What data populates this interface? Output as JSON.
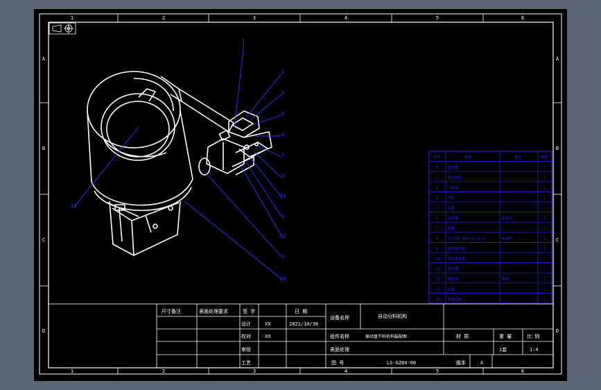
{
  "background_color": "#5b6573",
  "paper_color": "#000000",
  "frame_color": "#ffffff",
  "bom_color": "#2222ff",
  "leader_color": "#3030ff",
  "border_zones": {
    "top": [
      "1",
      "2",
      "3",
      "4",
      "5",
      "6"
    ],
    "bottom": [
      "1",
      "2",
      "3",
      "4",
      "5",
      "6"
    ],
    "left": [
      "A",
      "B",
      "C",
      "D"
    ],
    "right": [
      "A",
      "B",
      "C",
      "D"
    ]
  },
  "balloons": [
    "1",
    "2",
    "3",
    "8",
    "4",
    "7",
    "1",
    "10",
    "3",
    "12",
    "9",
    "11",
    "13"
  ],
  "bom": {
    "headers": [
      "序号",
      "名称",
      "备注",
      "数量"
    ],
    "rows": [
      {
        "no": "1",
        "name": "振动盘",
        "remark": "",
        "qty": "1"
      },
      {
        "no": "2",
        "name": "直线送料",
        "remark": "",
        "qty": "1"
      },
      {
        "no": "3",
        "name": "分料块",
        "remark": "",
        "qty": "1"
      },
      {
        "no": "4",
        "name": "气缸",
        "remark": "",
        "qty": "1"
      },
      {
        "no": "5",
        "name": "支架",
        "remark": "",
        "qty": "1"
      },
      {
        "no": "6",
        "name": "固定板",
        "remark": "标准件",
        "qty": "1"
      },
      {
        "no": "7",
        "name": "底板",
        "remark": "",
        "qty": "1"
      },
      {
        "no": "8",
        "name": "S-CD55_M58_D5_4%_0",
        "remark": "标准件",
        "qty": "1"
      },
      {
        "no": "9",
        "name": "感应器支架",
        "remark": "",
        "qty": "1"
      },
      {
        "no": "10",
        "name": "感应器支架",
        "remark": "",
        "qty": "1"
      },
      {
        "no": "11",
        "name": "感应器",
        "remark": "",
        "qty": "1"
      },
      {
        "no": "12",
        "name": "推料块",
        "remark": "标准",
        "qty": "1"
      },
      {
        "no": "13",
        "name": "料盘",
        "remark": "",
        "qty": "1"
      },
      {
        "no": "13",
        "name": "料盘支架",
        "remark": "",
        "qty": "1"
      }
    ]
  },
  "title_block": {
    "dims": "尺寸备注",
    "std": "表面处理要求",
    "sign": "签 字",
    "date": "日 期",
    "design": "设计",
    "design_sign": "XX",
    "design_date": "2021/10/30",
    "check": "校对",
    "check_sign": "XX",
    "audit": "审核",
    "craft": "工艺",
    "project_label": "设备名称",
    "project_name": "自动分料机构",
    "assembly_label": "组件名称",
    "assembly_name": "振动盘下料机构装配图",
    "material_label": "材 质",
    "weight_label": "重 量",
    "scale_label": "比 例",
    "surface_label": "表面处理",
    "quantity": "1套",
    "scale": "1:4",
    "drawing_no_label": "图 号",
    "drawing_no": "LS-GZ04-00",
    "version_label": "版本",
    "version": "A"
  }
}
